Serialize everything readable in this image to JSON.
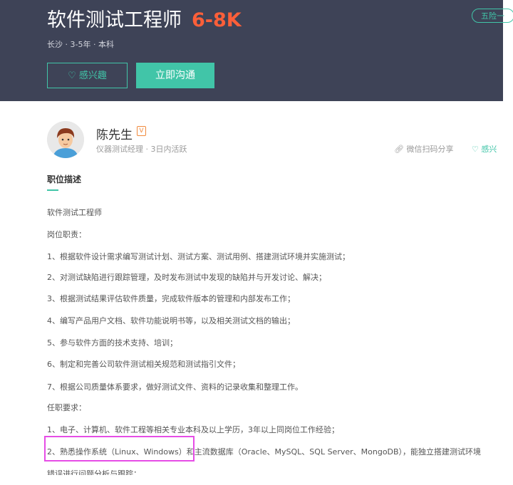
{
  "header": {
    "title": "软件测试工程师",
    "salary": "6-8K",
    "meta": "长沙 · 3-5年 · 本科",
    "welfare_badge": "五险一",
    "interest_button": "感兴趣",
    "chat_button": "立即沟通"
  },
  "recruiter": {
    "name": "陈先生",
    "verify_badge": "V",
    "meta": "仪器测试经理  ·  3日内活跃",
    "share": "微信扫码分享",
    "interest": "感兴"
  },
  "section": {
    "title": "职位描述"
  },
  "description": [
    "软件测试工程师",
    "岗位职责：",
    "1、根据软件设计需求编写测试计划、测试方案、测试用例、搭建测试环境并实施测试；",
    "2、对测试缺陷进行跟踪管理，及时发布测试中发现的缺陷并与开发讨论、解决；",
    "3、根据测试结果评估软件质量，完成软件版本的管理和内部发布工作；",
    "4、编写产品用户文档、软件功能说明书等，以及相关测试文档的输出；",
    "5、参与软件方面的技术支持、培训；",
    "6、制定和完善公司软件测试相关规范和测试指引文件；",
    "7、根据公司质量体系要求，做好测试文件、资料的记录收集和整理工作。",
    "任职要求：",
    "1、电子、计算机、软件工程等相关专业本科及以上学历，3年以上同岗位工作经验；",
    "2、熟悉操作系统（Linux、Windows）和主流数据库（Oracle、MySQL、SQL Server、MongoDB），能独立搭建测试环境",
    "错误进行问题分析与跟踪；"
  ],
  "colors": {
    "header_bg": "#3e4357",
    "accent": "#41c5a8",
    "salary": "#fd5f39",
    "highlight": "#e64de6"
  }
}
